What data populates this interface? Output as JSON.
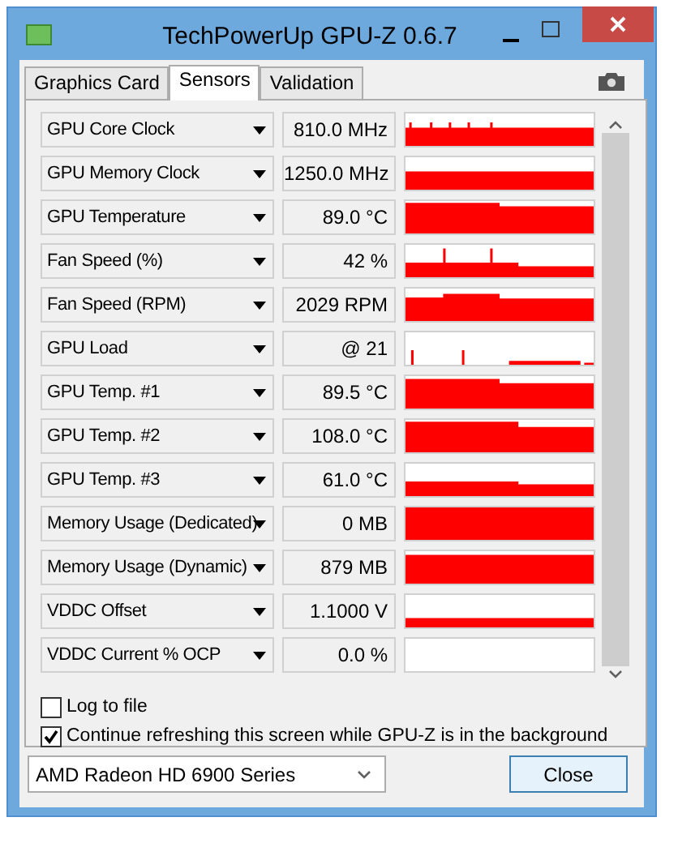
{
  "window": {
    "title": "TechPowerUp GPU-Z 0.6.7"
  },
  "tabs": [
    {
      "label": "Graphics Card",
      "selected": false
    },
    {
      "label": "Sensors",
      "selected": true
    },
    {
      "label": "Validation",
      "selected": false
    }
  ],
  "sensors": [
    {
      "name": "GPU Core Clock",
      "value": "810.0 MHz"
    },
    {
      "name": "GPU Memory Clock",
      "value": "1250.0 MHz"
    },
    {
      "name": "GPU Temperature",
      "value": "89.0 °C"
    },
    {
      "name": "Fan Speed (%)",
      "value": "42 %"
    },
    {
      "name": "Fan Speed (RPM)",
      "value": "2029 RPM"
    },
    {
      "name": "GPU Load",
      "value": "@ 21"
    },
    {
      "name": "GPU Temp. #1",
      "value": "89.5 °C"
    },
    {
      "name": "GPU Temp. #2",
      "value": "108.0 °C"
    },
    {
      "name": "GPU Temp. #3",
      "value": "61.0 °C"
    },
    {
      "name": "Memory Usage (Dedicated)",
      "value": "0 MB"
    },
    {
      "name": "Memory Usage (Dynamic)",
      "value": "879 MB"
    },
    {
      "name": "VDDC Offset",
      "value": "1.1000 V"
    },
    {
      "name": "VDDC Current % OCP",
      "value": "0.0 %"
    }
  ],
  "options": [
    {
      "label": "Log to file",
      "checked": false
    },
    {
      "label": "Continue refreshing this screen while GPU-Z is in the background",
      "checked": true
    }
  ],
  "device": {
    "value": "AMD Radeon HD 6900 Series"
  },
  "buttons": [
    "Close"
  ]
}
